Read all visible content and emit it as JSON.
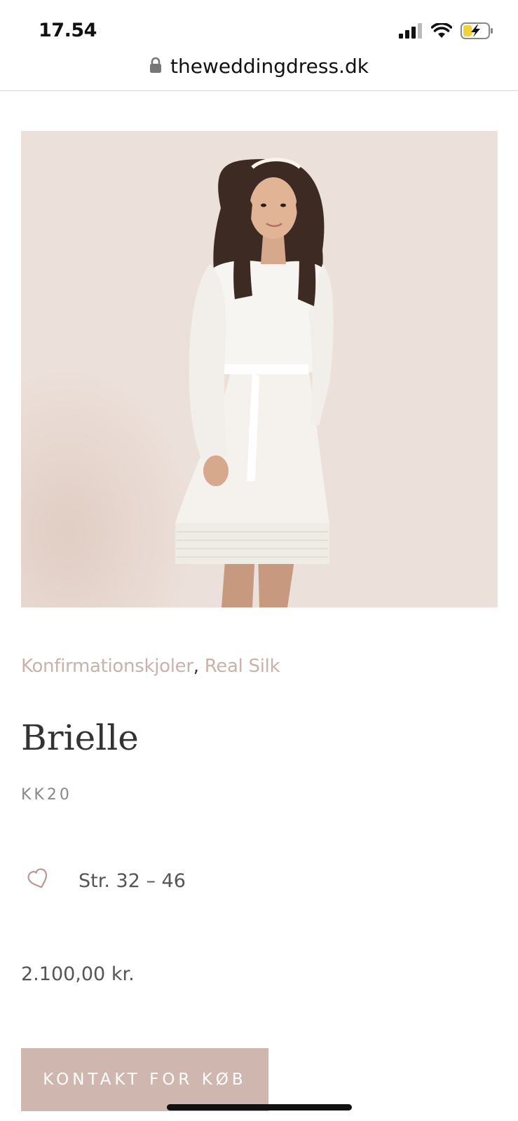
{
  "status_bar": {
    "time": "17.54",
    "icons": [
      "signal-icon",
      "wifi-icon",
      "battery-charging-icon"
    ]
  },
  "browser": {
    "url": "theweddingdress.dk",
    "lock_icon": "lock-icon"
  },
  "product": {
    "image_alt_icon": "product-photo",
    "categories": [
      {
        "label": "Konfirmationskjoler"
      },
      {
        "label": "Real Silk"
      }
    ],
    "category_separator": ", ",
    "title": "Brielle",
    "sku": "KK20",
    "size_icon": "heart-icon",
    "sizes": "Str. 32 – 46",
    "price": "2.100,00 kr.",
    "buy_button_label": "KONTAKT FOR KØB"
  },
  "colors": {
    "accent": "#cfb7b0",
    "category_link": "#c9b2ab",
    "image_background": "#ece0da"
  }
}
